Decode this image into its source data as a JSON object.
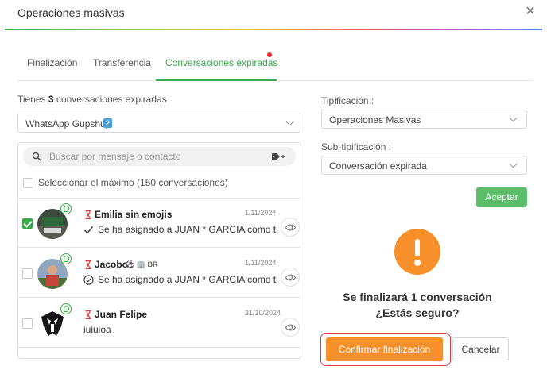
{
  "header": {
    "title": "Operaciones masivas",
    "close_icon": "close-icon"
  },
  "tabs": [
    {
      "label": "Finalización"
    },
    {
      "label": "Transferencia"
    },
    {
      "label": "Conversaciones expiradas",
      "active": true
    }
  ],
  "summary": {
    "prefix": "Tienes",
    "count": "3",
    "suffix": "conversaciones expiradas"
  },
  "channel": {
    "label": "WhatsApp Gupshup",
    "badge": "2"
  },
  "search": {
    "placeholder": "Buscar por mensaje o contacto"
  },
  "select_max": {
    "label": "Seleccionar el máximo (150 conversaciones)"
  },
  "conversations": [
    {
      "name": "Emilia sin emojis",
      "date": "1/11/2024",
      "message": "Se ha asignado a JUAN * GARCIA como tu a...",
      "checked": true
    },
    {
      "name": "Jacobo",
      "date": "1/11/2024",
      "message": "Se ha asignado a JUAN * GARCIA como tu a...",
      "checked": false,
      "extra": "BR"
    },
    {
      "name": "Juan Felipe",
      "date": "31/10/2024",
      "message": "iuiuioa",
      "checked": false
    }
  ],
  "tipificacion": {
    "label": "Tipificación :",
    "value": "Operaciones Masivas"
  },
  "subtipificacion": {
    "label": "Sub-tipificación :",
    "value": "Conversación expirada"
  },
  "accept_label": "Aceptar",
  "confirm": {
    "line1": "Se finalizará 1 conversación",
    "line2": "¿Estás seguro?",
    "confirm_label": "Confirmar finalización",
    "cancel_label": "Cancelar"
  },
  "colors": {
    "accent": "#3aa94a",
    "warning": "#f78f2a",
    "highlight": "#e0383f"
  }
}
